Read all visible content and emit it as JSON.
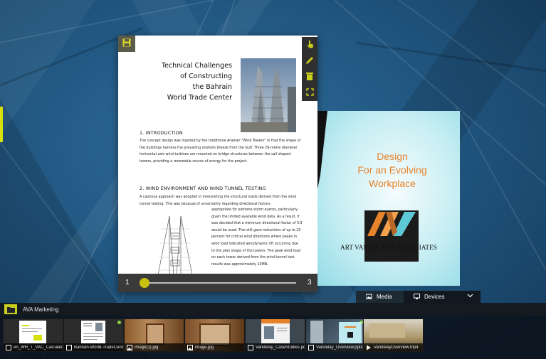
{
  "workspace": {
    "strip_title": "AVA Marketing"
  },
  "document": {
    "title_lines": [
      "Technical Challenges",
      "of Constructing",
      "the Bahrain",
      "World Trade Center"
    ],
    "section1_heading": "1. INTRODUCTION",
    "section1_text": "The concept design was inspired by the traditional Arabian \"Wind Towers\" in that the shape of the buildings harness the prevailing onshore breeze from the Gulf. Three 29-metre diameter horizontal axis wind turbines are mounted on bridge structures between the sail shaped towers, providing a renewable source of energy for the project.",
    "section2_heading": "2. WIND ENVIRONMENT AND WIND TUNNEL TESTING",
    "section2_text_a": "A cautious approach was adopted in interpreting the structural loads derived from the wind tunnel testing. This was because of uncertainty regarding directional factors",
    "section2_text_b": "appropriate for extreme storm events, particularly given the limited available wind data. As a result, it was decided that a minimum directional factor of 0.9 would be used. This still gave reductions of up to 20 percent for critical wind directions where peaks in wind load indicated aerodynamic lift occurring due to the plan shape of the towers. The peak wind load on each tower derived from the wind tunnel test results was approximately 10MN.",
    "current_page": "1",
    "total_pages": "3",
    "page_progress": 0.0
  },
  "slide": {
    "title_line1": "Design",
    "title_line2": "For an Evolving",
    "title_line3": "Workplace",
    "company": "ART VANDELAY & ASSOCIATES"
  },
  "tabs": {
    "media": "Media",
    "devices": "Devices"
  },
  "thumbnails": [
    {
      "label": "en_WH_T_VAC_Calculation",
      "type_icon": "pdf-icon"
    },
    {
      "label": "Bahrain-World-TradeCenter",
      "type_icon": "pdf-icon"
    },
    {
      "label": "image(1).jpg",
      "type_icon": "image-icon"
    },
    {
      "label": "image.jpg",
      "type_icon": "image-icon"
    },
    {
      "label": "Vandelay_CaseStudies.pdf",
      "type_icon": "pdf-icon"
    },
    {
      "label": "Vandelay_Overview.pptx",
      "type_icon": "pdf-icon"
    },
    {
      "label": "VandelayOverview.mp4",
      "type_icon": "video-icon"
    }
  ],
  "colors": {
    "accent": "#c9cf1c",
    "slide_title": "#e6822a",
    "logo_orange": "#e6822a",
    "logo_teal": "#5ec9d6"
  }
}
